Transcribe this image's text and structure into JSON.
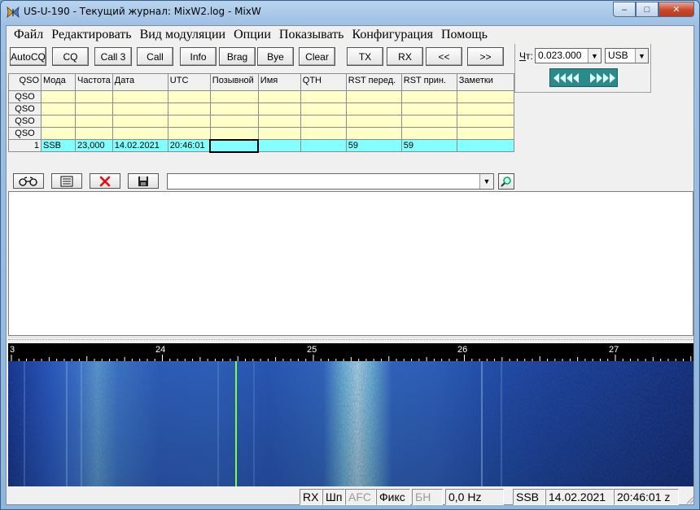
{
  "window": {
    "title": "US-U-190 - Текущий журнал: MixW2.log - MixW",
    "minimize": "–",
    "maximize": "□",
    "close": "✕"
  },
  "menu": [
    "Файл",
    "Редактировать",
    "Вид модуляции",
    "Опции",
    "Показывать",
    "Конфигурация",
    "Помощь"
  ],
  "toolbar": [
    "AutoCQ",
    "CQ",
    "Call 3",
    "Call",
    "Info",
    "Brag",
    "Bye",
    "Clear",
    "TX",
    "RX",
    "<<",
    ">>"
  ],
  "freq_panel": {
    "label_prefix": "Ч",
    "label_rest": "т:",
    "frequency": "0.023.000",
    "mode": "USB"
  },
  "log": {
    "columns": [
      "QSO",
      "Мода",
      "Частота",
      "Дата",
      "UTC",
      "Позывной",
      "Имя",
      "QTH",
      "RST перед.",
      "RST прин.",
      "Заметки"
    ],
    "empty_row_label": "QSO",
    "current": {
      "num": "1",
      "mode": "SSB",
      "freq": "23,000",
      "date": "14.02.2021",
      "utc": "20:46:01",
      "call": "",
      "name": "",
      "qth": "",
      "rst_sent": "59",
      "rst_rcvd": "59",
      "notes": ""
    }
  },
  "log_tools": {
    "search_value": ""
  },
  "scale": {
    "labels": [
      "3",
      "24",
      "25",
      "26",
      "27"
    ],
    "side_marker": "7"
  },
  "status": {
    "rx": "RX",
    "squelch": "Шп",
    "afc": "AFC",
    "fix": "Фикс",
    "bn": "БН",
    "offset": "0,0 Hz",
    "mode": "SSB",
    "date": "14.02.2021",
    "time": "20:46:01 z"
  },
  "colors": {
    "log_empty": "#ffffc8",
    "log_current": "#84ffff",
    "tune_strip": "#2b8a8a",
    "waterfall_base": "#0a1e6e",
    "cursor_line": "#7cff3a"
  }
}
